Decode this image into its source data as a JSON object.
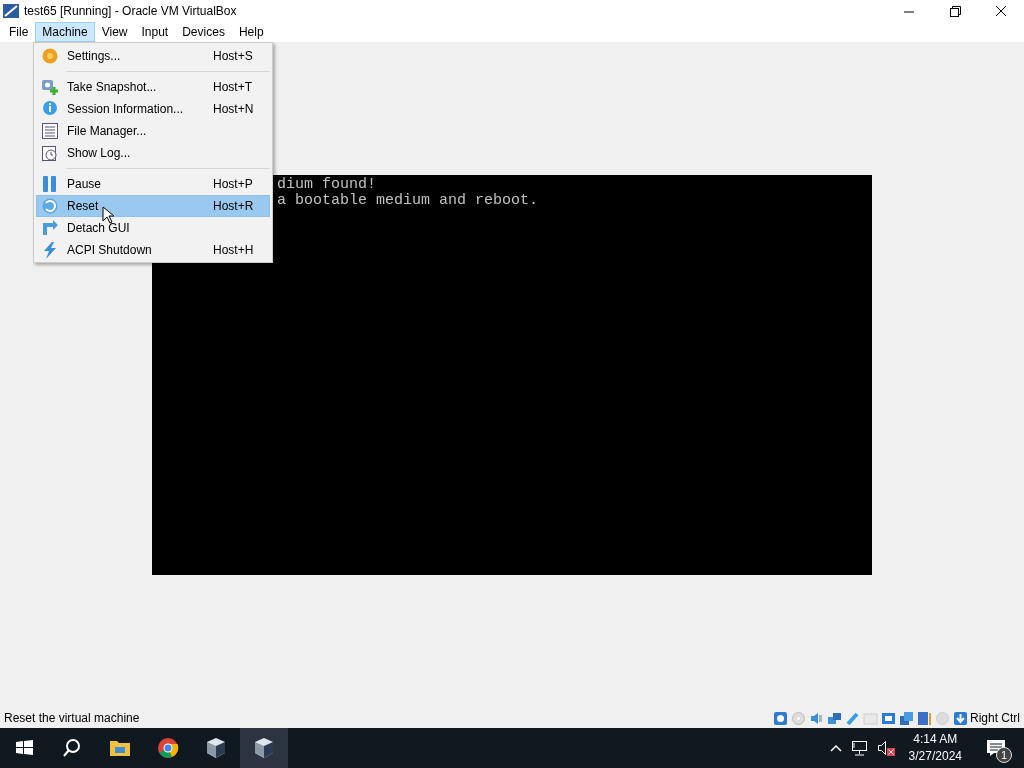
{
  "window": {
    "title": "test65 [Running] - Oracle VM VirtualBox"
  },
  "menubar": [
    {
      "label": "File",
      "selected": false
    },
    {
      "label": "Machine",
      "selected": true
    },
    {
      "label": "View",
      "selected": false
    },
    {
      "label": "Input",
      "selected": false
    },
    {
      "label": "Devices",
      "selected": false
    },
    {
      "label": "Help",
      "selected": false
    }
  ],
  "menu": [
    {
      "kind": "item",
      "label": "Settings...",
      "shortcut": "Host+S",
      "selected": false
    },
    {
      "kind": "separator"
    },
    {
      "kind": "item",
      "label": "Take Snapshot...",
      "shortcut": "Host+T",
      "selected": false
    },
    {
      "kind": "item",
      "label": "Session Information...",
      "shortcut": "Host+N",
      "selected": false
    },
    {
      "kind": "item",
      "label": "File Manager...",
      "selected": false
    },
    {
      "kind": "item",
      "label": "Show Log...",
      "selected": false
    },
    {
      "kind": "separator"
    },
    {
      "kind": "item",
      "label": "Pause",
      "shortcut": "Host+P",
      "selected": false
    },
    {
      "kind": "item",
      "label": "Reset",
      "shortcut": "Host+R",
      "selected": true
    },
    {
      "kind": "item",
      "label": "Detach GUI",
      "selected": false
    },
    {
      "kind": "item",
      "label": "ACPI Shutdown",
      "shortcut": "Host+H",
      "selected": false
    }
  ],
  "vm_screen": {
    "lines": [
      "dium found!",
      "a bootable medium and reboot."
    ]
  },
  "status_bar": {
    "message": "Reset the virtual machine",
    "host_key": "Right Ctrl"
  },
  "taskbar": {
    "time": "4:14 AM",
    "date": "3/27/2024",
    "notification_count": "1"
  }
}
